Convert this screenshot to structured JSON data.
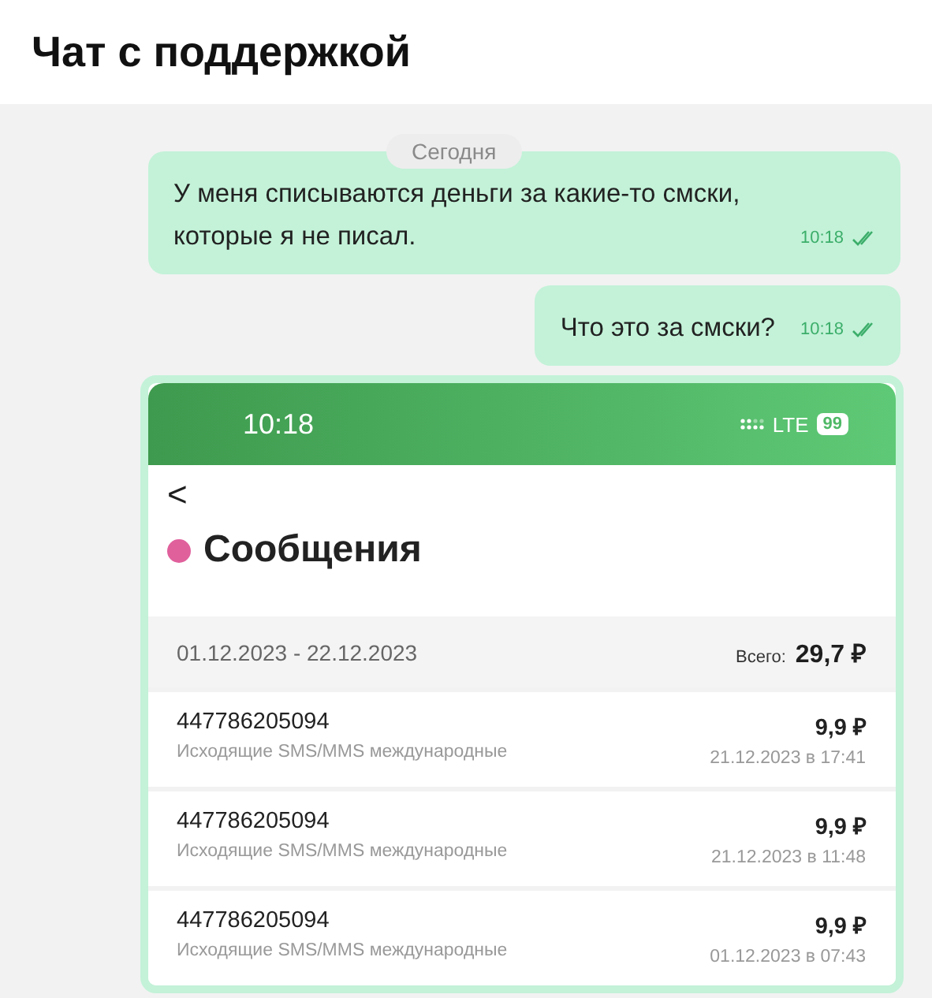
{
  "header": {
    "title": "Чат с поддержкой"
  },
  "date_divider": "Сегодня",
  "messages": [
    {
      "text": "У меня списываются деньги за какие-то смски, которые я не писал.",
      "time": "10:18",
      "read": true
    },
    {
      "text": "Что это за смски?",
      "time": "10:18",
      "read": true
    }
  ],
  "attachment": {
    "kind": "screenshot",
    "status_bar": {
      "time": "10:18",
      "network": "LTE",
      "battery": "99"
    },
    "back": "<",
    "title": "Сообщения",
    "period": "01.12.2023 - 22.12.2023",
    "total_label": "Всего:",
    "total": "29,7 ₽",
    "rows": [
      {
        "number": "447786205094",
        "description": "Исходящие SMS/MMS международные",
        "amount": "9,9 ₽",
        "date": "21.12.2023 в 17:41"
      },
      {
        "number": "447786205094",
        "description": "Исходящие SMS/MMS международные",
        "amount": "9,9 ₽",
        "date": "21.12.2023 в 11:48"
      },
      {
        "number": "447786205094",
        "description": "Исходящие SMS/MMS международные",
        "amount": "9,9 ₽",
        "date": "01.12.2023 в 07:43"
      }
    ]
  }
}
